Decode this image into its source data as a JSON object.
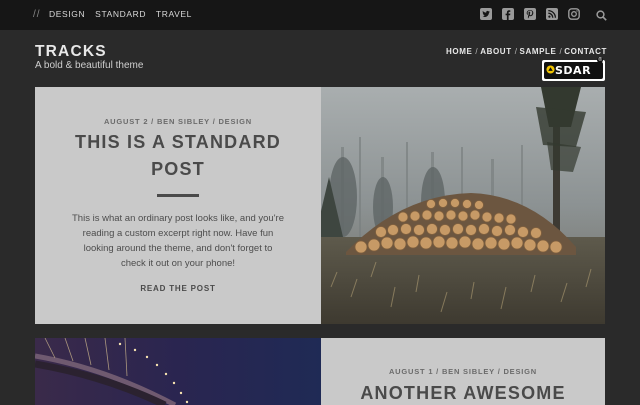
{
  "topbar": {
    "slashes": "//",
    "categories": [
      "DESIGN",
      "STANDARD",
      "TRAVEL"
    ],
    "social_icons": [
      "twitter-icon",
      "facebook-icon",
      "pinterest-icon",
      "rss-icon",
      "instagram-icon"
    ]
  },
  "site": {
    "title": "TRACKS",
    "tagline": "A bold & beautiful theme"
  },
  "nav": {
    "items": [
      "HOME",
      "ABOUT",
      "SAMPLE",
      "CONTACT"
    ],
    "separator": "/"
  },
  "badge": {
    "text": "SDAR",
    "sup": "®"
  },
  "posts": [
    {
      "meta": "AUGUST 2 / BEN SIBLEY / DESIGN",
      "title_line1": "THIS IS A STANDARD",
      "title_line2": "POST",
      "excerpt_lines": [
        "This is what an ordinary post looks like, and you're",
        "reading a custom excerpt right now. Have fun",
        "looking around the theme, and don't forget to",
        "check it out on your phone!"
      ],
      "read_more": "READ THE POST"
    },
    {
      "meta": "AUGUST 1 / BEN SIBLEY / DESIGN",
      "title_line1": "ANOTHER AWESOME"
    }
  ],
  "colors": {
    "page_bg": "#2a2a2a",
    "topbar_bg": "#161616",
    "panel_bg": "#c9c9c9",
    "title_text": "#4a4a4a"
  }
}
